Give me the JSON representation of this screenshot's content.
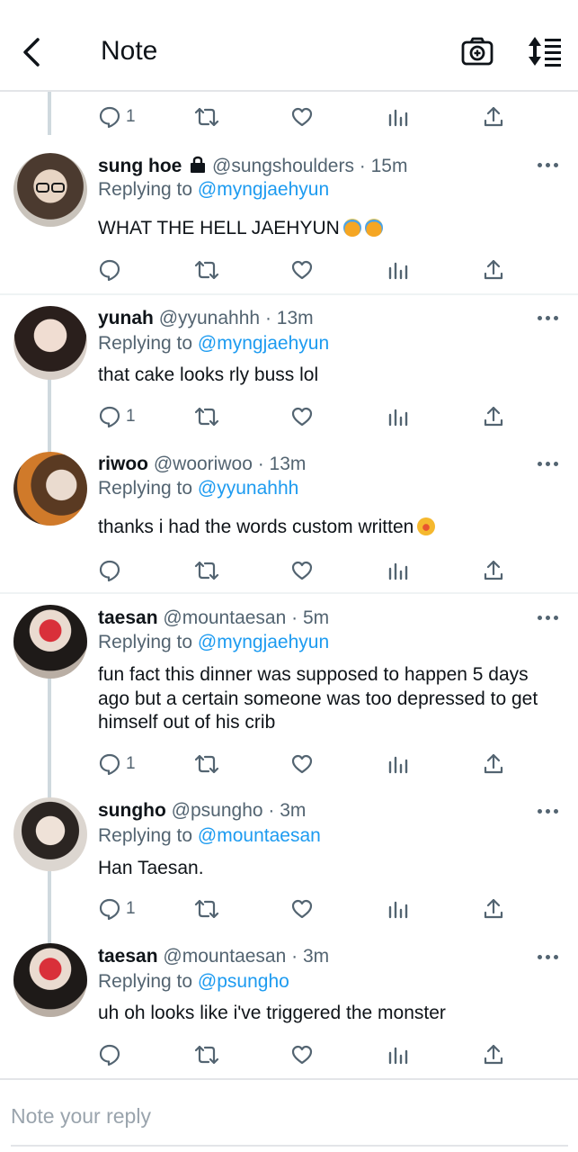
{
  "header": {
    "title": "Note",
    "back_icon": "chevron-left-icon",
    "camera_icon": "camera-plus-icon",
    "sort_icon": "sort-list-icon"
  },
  "colors": {
    "link": "#1d9bf0",
    "secondary": "#536471",
    "thread_line": "#cfd9de",
    "divider": "#eff3f4"
  },
  "top_actions": {
    "reply_count": "1"
  },
  "tweets": [
    {
      "name": "sung hoe",
      "locked": true,
      "handle": "@sungshoulders",
      "time": "· 15m",
      "replying_label": "Replying to",
      "replying_to": "@myngjaehyun",
      "text": "WHAT THE HELL JAEHYUN",
      "emojis": [
        "loudly-crying-face",
        "loudly-crying-face"
      ],
      "reply_count": ""
    },
    {
      "name": "yunah",
      "handle": "@yyunahhh",
      "time": "· 13m",
      "replying_label": "Replying to",
      "replying_to": "@myngjaehyun",
      "text": "that cake looks rly buss lol",
      "reply_count": "1"
    },
    {
      "name": "riwoo",
      "handle": "@wooriwoo",
      "time": "· 13m",
      "replying_label": "Replying to",
      "replying_to": "@yyunahhh",
      "text": "thanks i had the words custom written",
      "emojis": [
        "star-struck-face"
      ],
      "reply_count": ""
    },
    {
      "name": "taesan",
      "handle": "@mountaesan",
      "time": "· 5m",
      "replying_label": "Replying to",
      "replying_to": "@myngjaehyun",
      "text": "fun fact this dinner was supposed to happen 5 days ago but a certain someone was too depressed to get himself out of his crib",
      "reply_count": "1"
    },
    {
      "name": "sungho",
      "handle": "@psungho",
      "time": "· 3m",
      "replying_label": "Replying to",
      "replying_to": "@mountaesan",
      "text": "Han Taesan.",
      "reply_count": "1"
    },
    {
      "name": "taesan",
      "handle": "@mountaesan",
      "time": "· 3m",
      "replying_label": "Replying to",
      "replying_to": "@psungho",
      "text": "uh oh looks like i've triggered the monster",
      "reply_count": ""
    }
  ],
  "reply_box": {
    "placeholder": "Note your reply"
  }
}
